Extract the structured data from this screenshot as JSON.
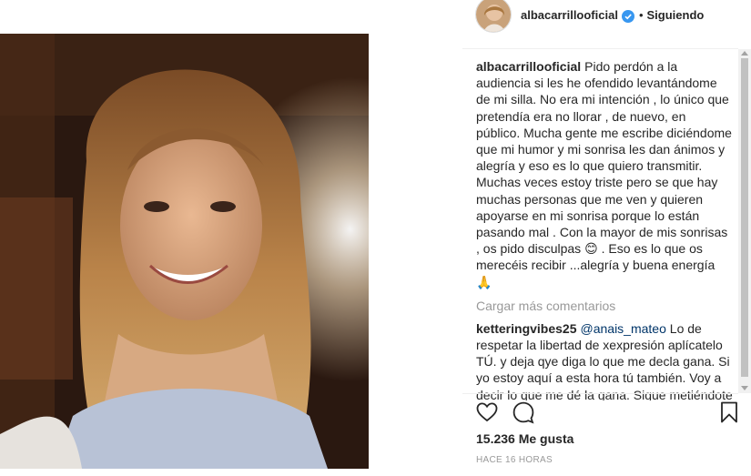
{
  "post": {
    "photo_alt": "Selfie photo",
    "username": "albacarrillooficial",
    "verified": true,
    "separator": "•",
    "follow_status": "Siguiendo"
  },
  "caption": {
    "username": "albacarrillooficial",
    "text_1": "Pido perdón a la audiencia si les he ofendido levantándome de mi silla. No era mi intención , lo único que pretendía era no llorar , de nuevo, en público. Mucha gente me escribe diciéndome que mi humor y mi sonrisa les dan ánimos y alegría y eso es lo que quiero transmitir. Muchas veces estoy triste pero se que hay muchas personas que me ven y quieren apoyarse en mi sonrisa porque lo están pasando mal . Con la mayor de mis sonrisas , os pido disculpas ",
    "emoji_1": "😊",
    "text_2": " . Eso es lo que os merecéis recibir ...alegría y buena energía ",
    "emoji_2": "🙏"
  },
  "load_more": "Cargar más comentarios",
  "comment_1": {
    "username": "ketteringvibes25",
    "mention": "@anais_mateo",
    "text": " Lo de respetar la libertad de xexpresión aplícatelo TÚ. y deja qye diga lo que me decla gana. Si yo estoy aquí a esta hora tú también. Voy a decir lo que me dé la gana. Sigue metiéndote"
  },
  "actions": {
    "like_icon": "heart-icon",
    "comment_icon": "comment-icon",
    "save_icon": "bookmark-icon"
  },
  "likes_text": "15.236 Me gusta",
  "timestamp": "HACE 16 HORAS",
  "colors": {
    "text": "#262626",
    "muted": "#999999",
    "verified": "#3897f0",
    "mention": "#003569"
  }
}
